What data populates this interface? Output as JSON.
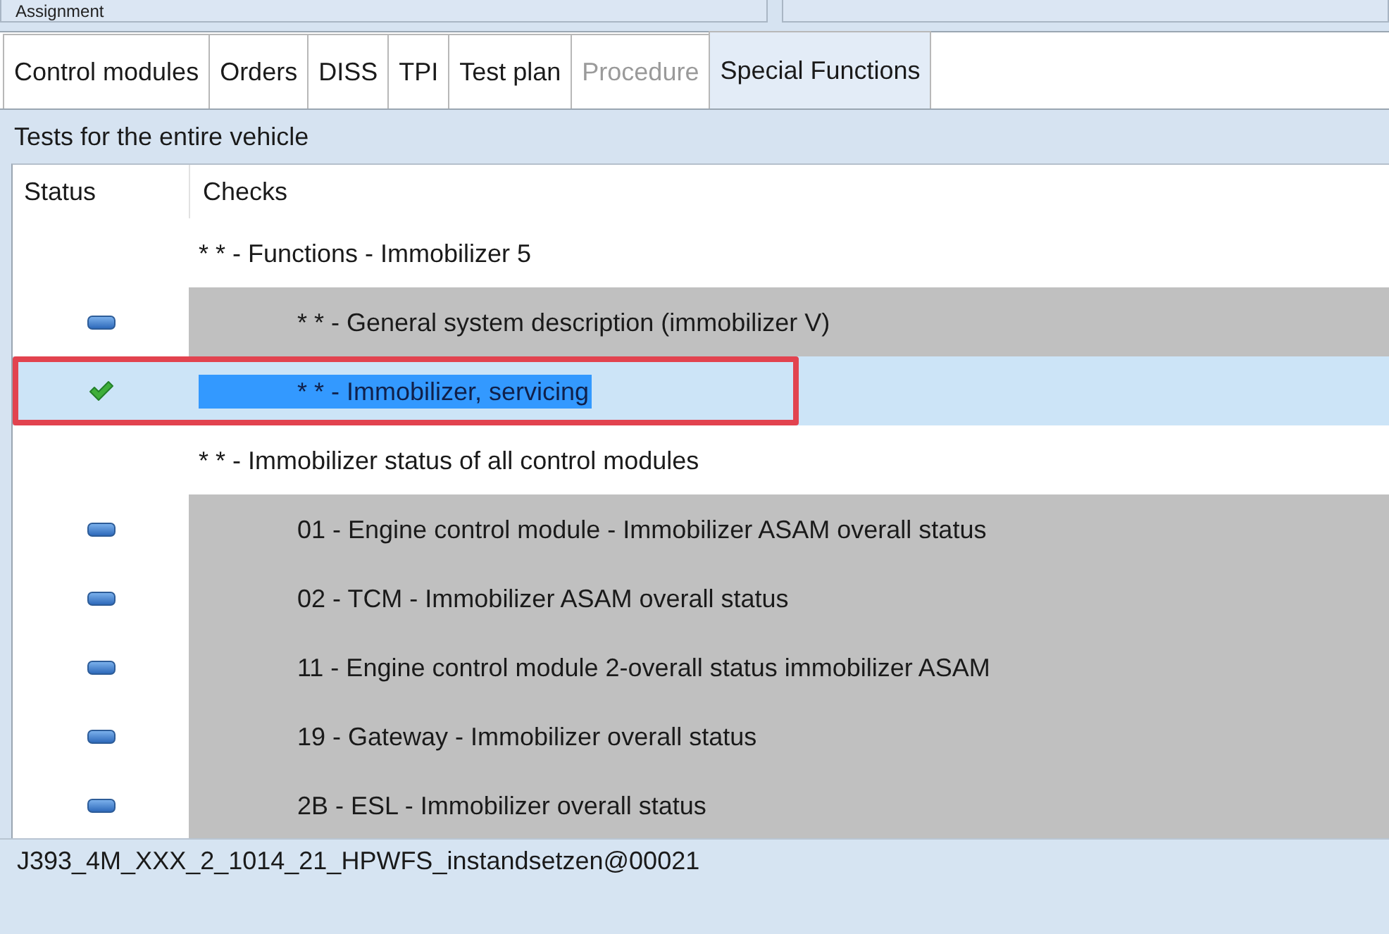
{
  "assignment_panel": {
    "title": "Assignment"
  },
  "tabs": [
    {
      "label": "Control modules",
      "selected": false,
      "disabled": false
    },
    {
      "label": "Orders",
      "selected": false,
      "disabled": false
    },
    {
      "label": "DISS",
      "selected": false,
      "disabled": false
    },
    {
      "label": "TPI",
      "selected": false,
      "disabled": false
    },
    {
      "label": "Test plan",
      "selected": false,
      "disabled": false
    },
    {
      "label": "Procedure",
      "selected": false,
      "disabled": true
    },
    {
      "label": "Special Functions",
      "selected": true,
      "disabled": false
    }
  ],
  "section_title": "Tests for the entire vehicle",
  "table": {
    "columns": [
      "Status",
      "Checks"
    ],
    "groups": [
      {
        "check": "* * - Functions - Immobilizer 5",
        "selected": false,
        "children": [
          {
            "check": "* * - General system description (immobilizer V)",
            "passed": false,
            "selected": false,
            "outlined": false
          },
          {
            "check": "* * - Immobilizer, servicing",
            "passed": true,
            "selected": true,
            "outlined": true
          }
        ]
      },
      {
        "check": "* * - Immobilizer status of all control modules",
        "selected": false,
        "children": [
          {
            "check": "01 - Engine control module - Immobilizer ASAM overall status",
            "passed": false,
            "selected": false,
            "outlined": false
          },
          {
            "check": "02 - TCM - Immobilizer ASAM overall status",
            "passed": false,
            "selected": false,
            "outlined": false
          },
          {
            "check": "11 - Engine control module 2-overall status immobilizer ASAM",
            "passed": false,
            "selected": false,
            "outlined": false
          },
          {
            "check": "19 - Gateway - Immobilizer overall status",
            "passed": false,
            "selected": false,
            "outlined": false
          },
          {
            "check": "2B - ESL - Immobilizer overall status",
            "passed": false,
            "selected": false,
            "outlined": false
          }
        ]
      }
    ]
  },
  "footer": {
    "text": "J393_4M_XXX_2_1014_21_HPWFS_instandsetzen@00021"
  }
}
